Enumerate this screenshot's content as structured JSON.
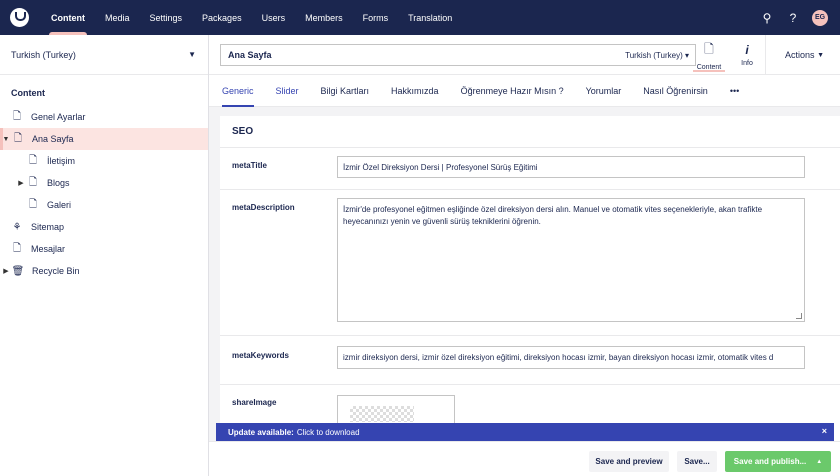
{
  "topnav": {
    "items": [
      "Content",
      "Media",
      "Settings",
      "Packages",
      "Users",
      "Members",
      "Forms",
      "Translation"
    ],
    "active": "Content",
    "avatar": "EG"
  },
  "sidebar": {
    "culture": "Turkish (Turkey)",
    "section_title": "Content",
    "tree": [
      {
        "label": "Genel Ayarlar",
        "icon": "document-icon"
      },
      {
        "label": "Ana Sayfa",
        "icon": "document-icon",
        "selected": true
      },
      {
        "label": "İletişim",
        "icon": "document-icon"
      },
      {
        "label": "Blogs",
        "icon": "document-icon"
      },
      {
        "label": "Galeri",
        "icon": "document-icon"
      },
      {
        "label": "Sitemap",
        "icon": "sitemap-icon"
      },
      {
        "label": "Mesajlar",
        "icon": "document-list-icon"
      },
      {
        "label": "Recycle Bin",
        "icon": "trash-icon"
      }
    ]
  },
  "header": {
    "node_name": "Ana Sayfa",
    "variant": "Turkish (Turkey)",
    "apps": [
      {
        "label": "Content"
      },
      {
        "label": "Info"
      }
    ],
    "actions_label": "Actions"
  },
  "tabs": [
    "Generic",
    "Slider",
    "Bilgi Kartları",
    "Hakkımızda",
    "Öğrenmeye Hazır Mısın ?",
    "Yorumlar",
    "Nasıl Öğrenirsin",
    "•••"
  ],
  "seo": {
    "title": "SEO",
    "meta_title_label": "metaTitle",
    "meta_title_value": "İzmir Özel Direksiyon Dersi | Profesyonel Sürüş Eğitimi",
    "meta_description_label": "metaDescription",
    "meta_description_value": "İzmir'de profesyonel eğitmen eşliğinde özel direksiyon dersi alın. Manuel ve otomatik vites seçenekleriyle, akan trafikte heyecanınızı yenin ve güvenli sürüş tekniklerini öğrenin.",
    "meta_keywords_label": "metaKeywords",
    "meta_keywords_value": "izmir direksiyon dersi, izmir özel direksiyon eğitimi, direksiyon hocası izmir, bayan direksiyon hocası izmir, otomatik vites d",
    "share_image_label": "shareImage"
  },
  "update_bar": {
    "bold": "Update available:",
    "text": "Click to download",
    "close": "×"
  },
  "footer": {
    "save_preview": "Save and preview",
    "save": "Save...",
    "save_publish": "Save and publish...",
    "save_publish_caret": "▲"
  }
}
